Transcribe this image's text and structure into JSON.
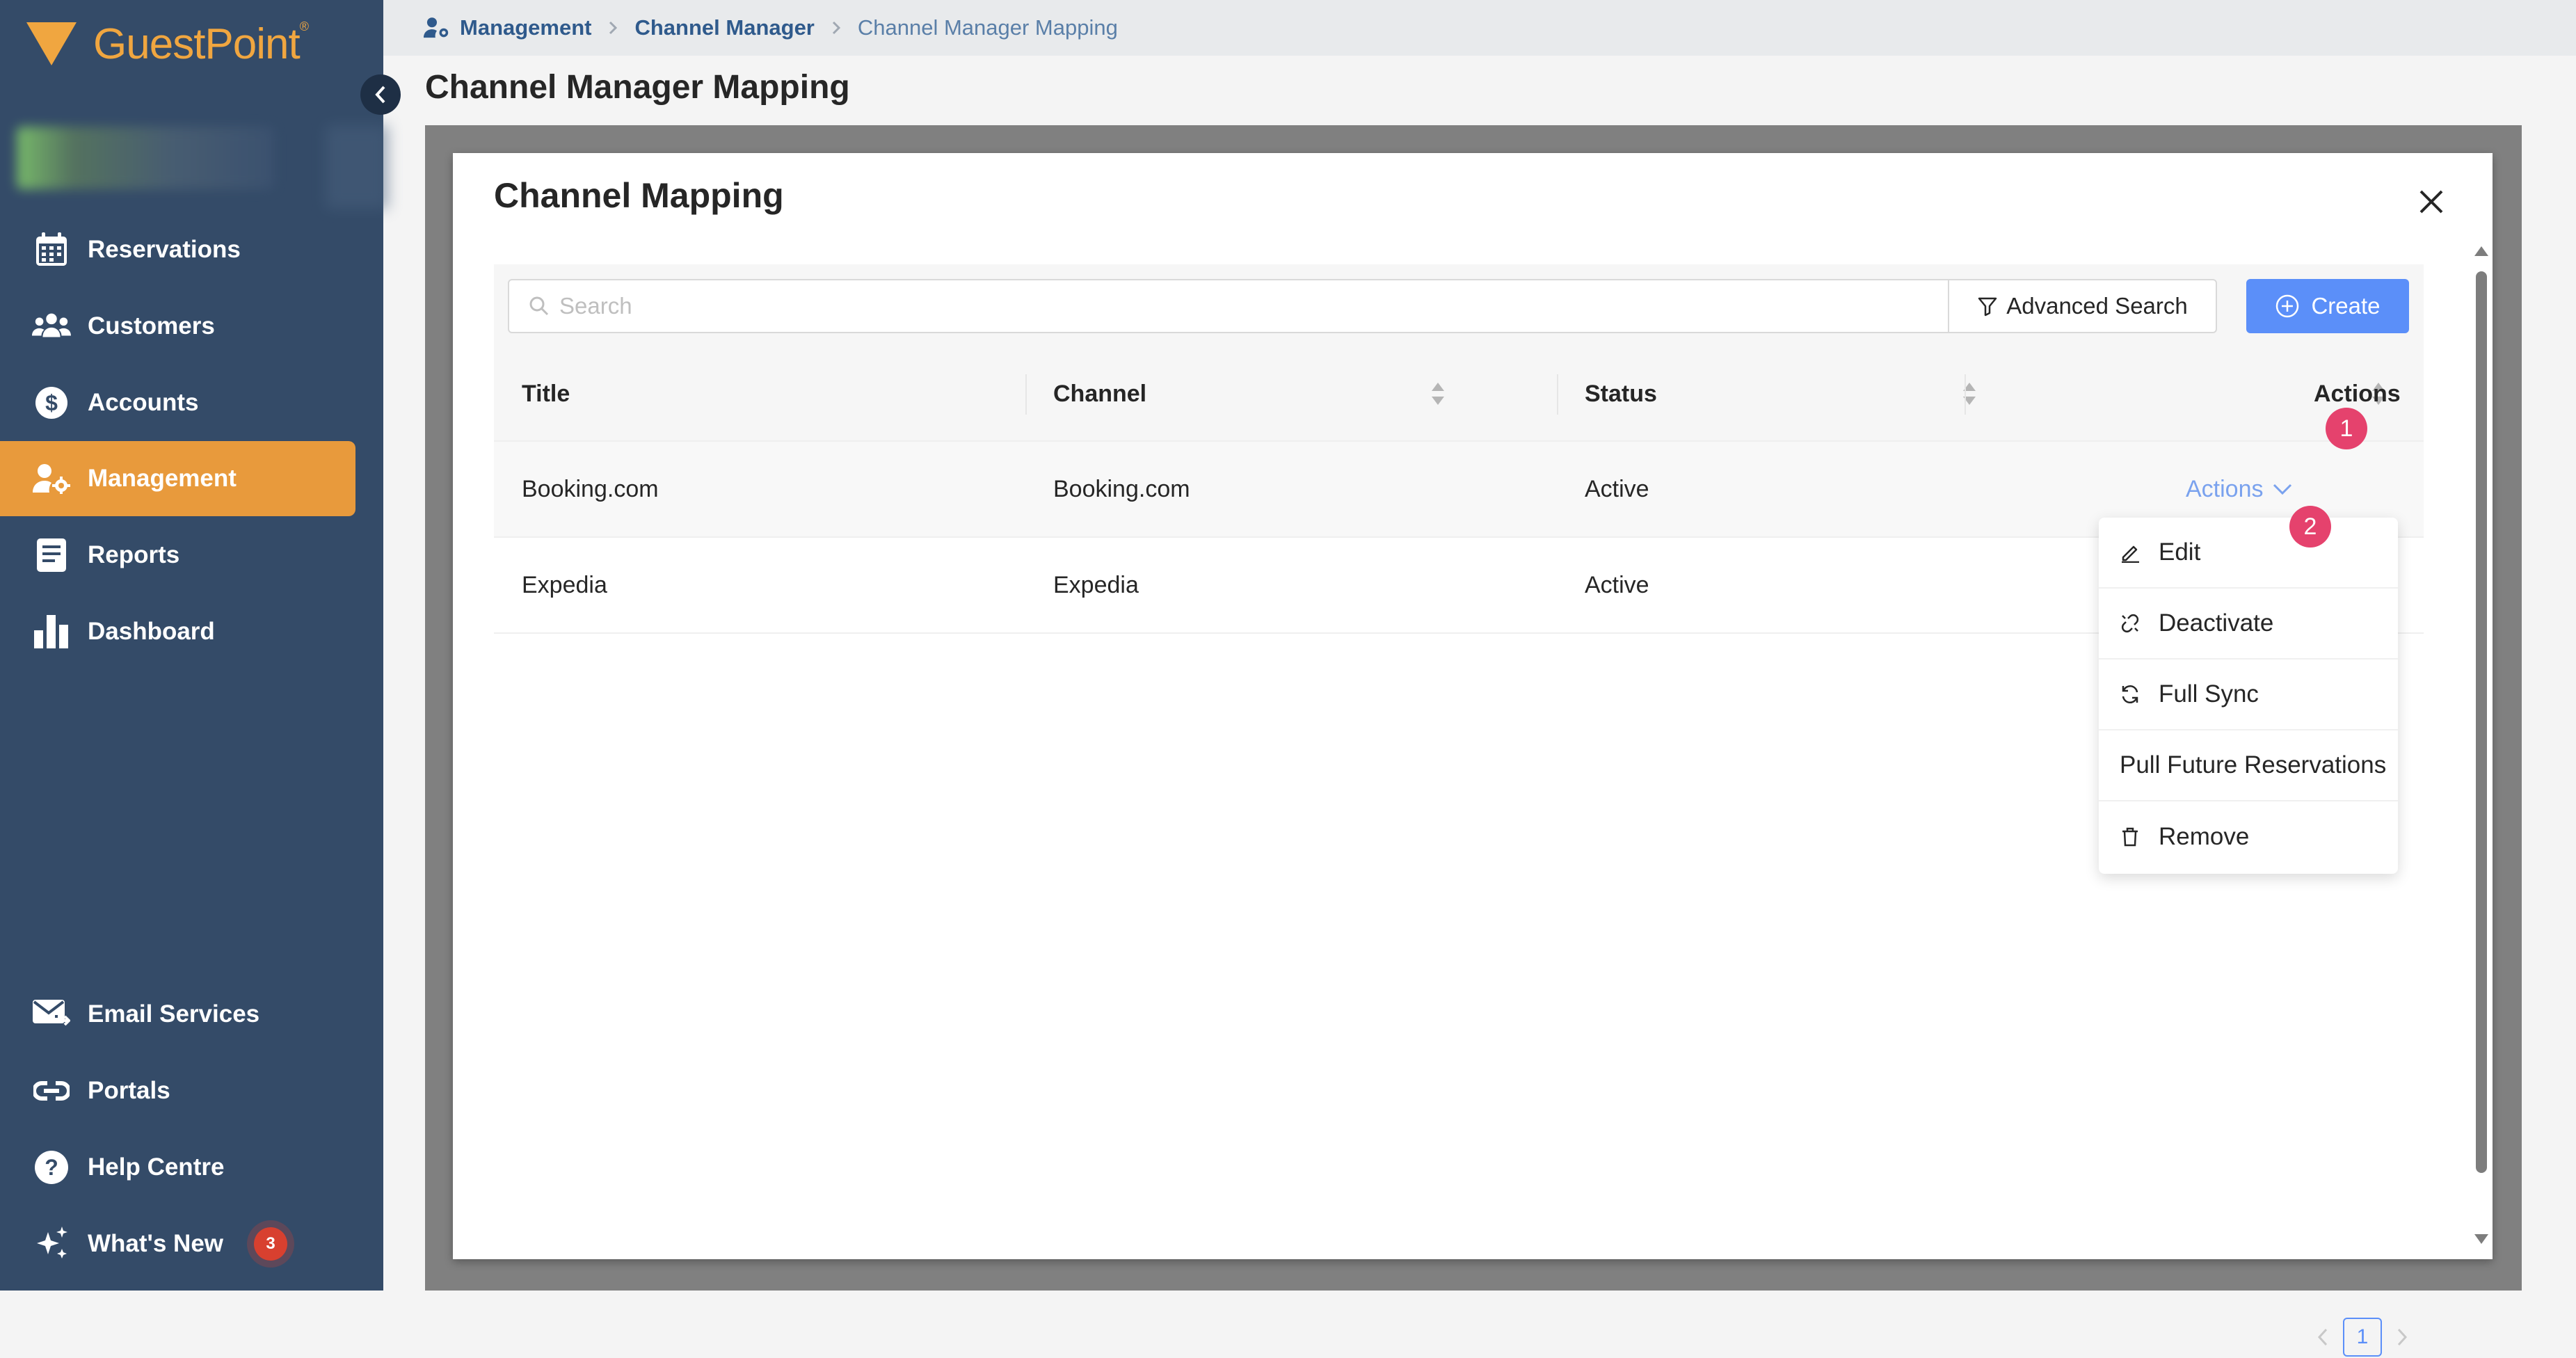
{
  "brand": {
    "name": "GuestPoint",
    "trademark": "®",
    "accent_color": "#f0a640"
  },
  "sidebar": {
    "items": [
      {
        "label": "Reservations",
        "icon": "calendar-icon"
      },
      {
        "label": "Customers",
        "icon": "users-icon"
      },
      {
        "label": "Accounts",
        "icon": "dollar-icon"
      },
      {
        "label": "Management",
        "icon": "user-gear-icon",
        "active": true
      },
      {
        "label": "Reports",
        "icon": "document-icon"
      },
      {
        "label": "Dashboard",
        "icon": "bar-chart-icon"
      }
    ],
    "footer_items": [
      {
        "label": "Email Services",
        "icon": "email-icon"
      },
      {
        "label": "Portals",
        "icon": "link-icon"
      },
      {
        "label": "Help Centre",
        "icon": "help-icon"
      },
      {
        "label": "What's New",
        "icon": "sparkle-icon",
        "badge": "3"
      }
    ]
  },
  "breadcrumb": [
    "Management",
    "Channel Manager",
    "Channel Manager Mapping"
  ],
  "page_title": "Channel Manager Mapping",
  "modal": {
    "title": "Channel Mapping",
    "search_placeholder": "Search",
    "advanced_search_label": "Advanced Search",
    "create_label": "Create",
    "columns": [
      "Title",
      "Channel",
      "Status",
      "Actions"
    ],
    "rows": [
      {
        "title": "Booking.com",
        "channel": "Booking.com",
        "status": "Active",
        "actions_label": "Actions"
      },
      {
        "title": "Expedia",
        "channel": "Expedia",
        "status": "Active",
        "actions_label": ""
      }
    ],
    "actions_menu": [
      {
        "label": "Edit",
        "icon": "edit-icon"
      },
      {
        "label": "Deactivate",
        "icon": "unlink-icon"
      },
      {
        "label": "Full Sync",
        "icon": "sync-icon"
      },
      {
        "label": "Pull Future Reservations",
        "icon": ""
      },
      {
        "label": "Remove",
        "icon": "trash-icon"
      }
    ],
    "step_markers": [
      "1",
      "2"
    ],
    "pagination": {
      "current_page": "1"
    }
  },
  "colors": {
    "sidebar": "#344b68",
    "active": "#e89a3c",
    "primary": "#5b8ff9",
    "marker": "#e5426d",
    "badge": "#d8402f"
  }
}
